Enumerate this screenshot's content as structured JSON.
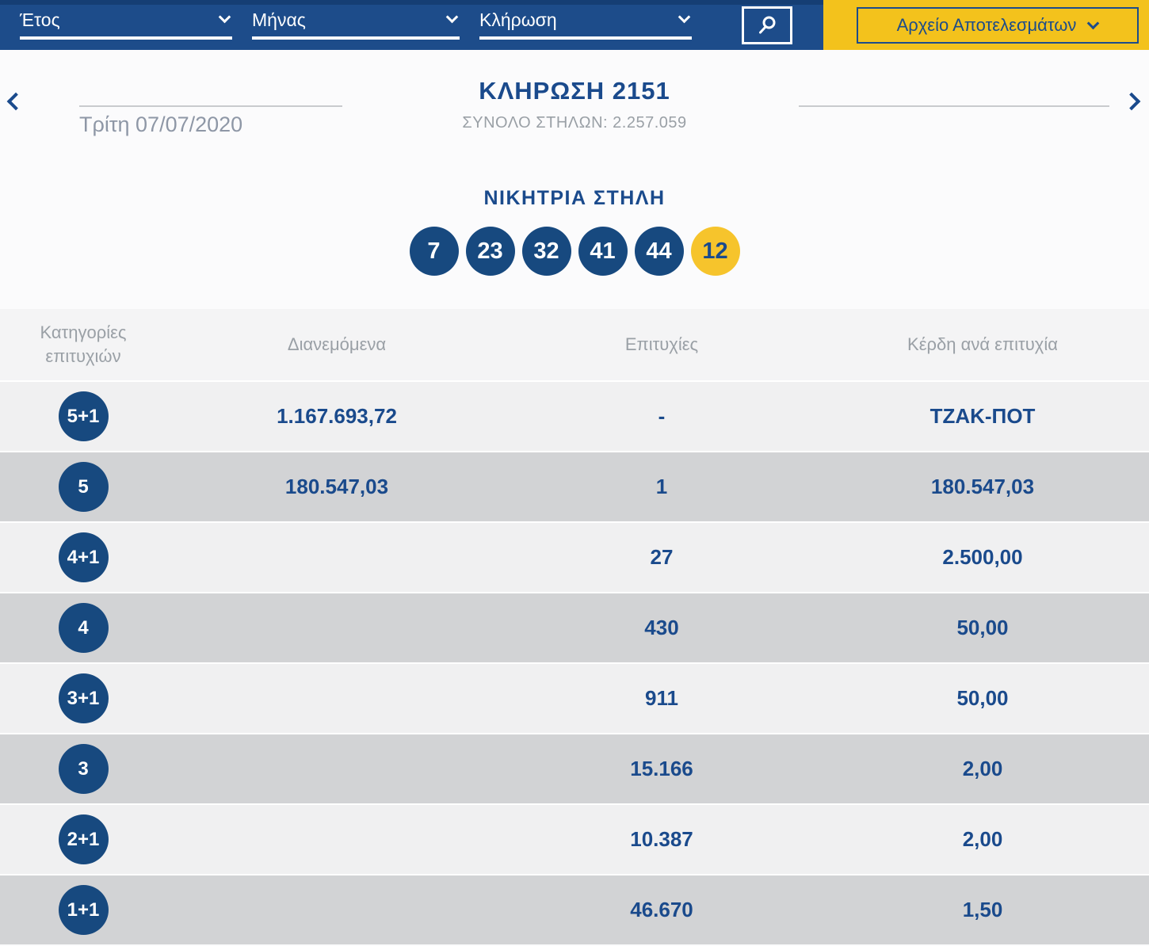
{
  "topbar": {
    "filters": [
      {
        "label": "Έτος"
      },
      {
        "label": "Μήνας"
      },
      {
        "label": "Κλήρωση"
      }
    ],
    "search_icon": "magnifier-icon",
    "archive_button_label": "Αρχείο Αποτελεσμάτων"
  },
  "draw_header": {
    "date": "Τρίτη 07/07/2020",
    "title": "ΚΛΗΡΩΣΗ 2151",
    "subtitle": "ΣΥΝΟΛΟ ΣΤΗΛΩΝ: 2.257.059"
  },
  "winning_column": {
    "title": "ΝΙΚΗΤΡΙΑ ΣΤΗΛΗ",
    "numbers": [
      "7",
      "23",
      "32",
      "41",
      "44"
    ],
    "joker": "12"
  },
  "table": {
    "headers": {
      "category": "Κατηγορίες επιτυχιών",
      "distributed": "Διανεμόμενα",
      "winners": "Επιτυχίες",
      "prize": "Κέρδη ανά επιτυχία"
    },
    "rows": [
      {
        "category": "5+1",
        "distributed": "1.167.693,72",
        "winners": "-",
        "prize": "ΤΖΑΚ-ΠΟΤ"
      },
      {
        "category": "5",
        "distributed": "180.547,03",
        "winners": "1",
        "prize": "180.547,03"
      },
      {
        "category": "4+1",
        "distributed": "",
        "winners": "27",
        "prize": "2.500,00"
      },
      {
        "category": "4",
        "distributed": "",
        "winners": "430",
        "prize": "50,00"
      },
      {
        "category": "3+1",
        "distributed": "",
        "winners": "911",
        "prize": "50,00"
      },
      {
        "category": "3",
        "distributed": "",
        "winners": "15.166",
        "prize": "2,00"
      },
      {
        "category": "2+1",
        "distributed": "",
        "winners": "10.387",
        "prize": "2,00"
      },
      {
        "category": "1+1",
        "distributed": "",
        "winners": "46.670",
        "prize": "1,50"
      }
    ]
  },
  "colors": {
    "topbar_blue": "#1d4c8a",
    "topbar_blue_dark": "#153e74",
    "accent_yellow": "#f3c21c",
    "ball_blue": "#17497f",
    "ball_yellow": "#f6c42c",
    "title_blue": "#1a4a8c",
    "muted_gray": "#9aa0a6",
    "row_light": "#f0f0f1",
    "row_dark": "#d2d3d5"
  }
}
